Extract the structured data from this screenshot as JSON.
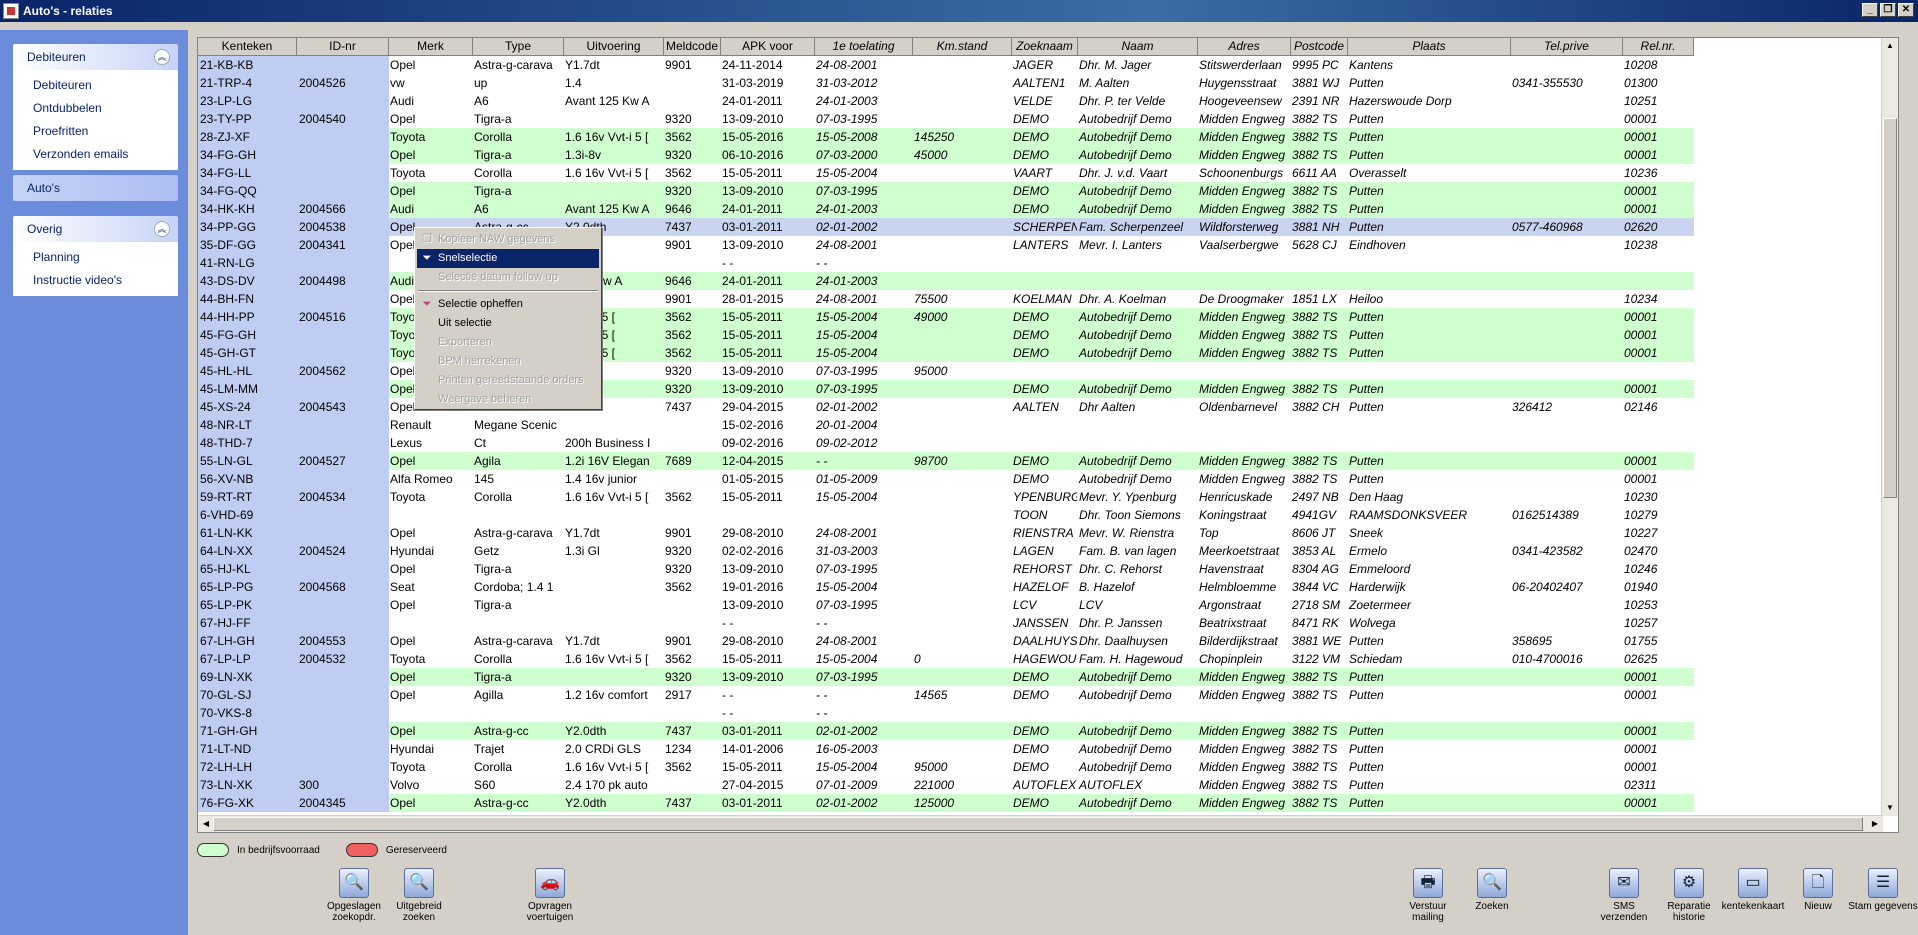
{
  "window": {
    "title": "Auto's - relaties"
  },
  "sidebar": {
    "groups": [
      {
        "title": "Debiteuren",
        "items": [
          "Debiteuren",
          "Ontdubbelen",
          "Proefritten",
          "Verzonden emails"
        ]
      },
      {
        "title": "Auto's",
        "items": []
      },
      {
        "title": "Overig",
        "items": [
          "Planning",
          "Instructie video's"
        ]
      }
    ]
  },
  "grid": {
    "columns": [
      "Kenteken",
      "ID-nr",
      "Merk",
      "Type",
      "Uitvoering",
      "Meldcode",
      "APK voor",
      "1e toelating",
      "Km.stand",
      "Zoeknaam",
      "Naam",
      "Adres",
      "Postcode",
      "Plaats",
      "Tel.prive",
      "Rel.nr."
    ],
    "rows": [
      {
        "s": "",
        "c": [
          "21-KB-KB",
          "",
          "Opel",
          "Astra-g-carava",
          "Y1.7dt",
          "9901",
          "24-11-2014",
          "24-08-2001",
          "",
          "JAGER",
          "Dhr. M. Jager",
          "Stitswerderlaan",
          "9995 PC",
          "Kantens",
          "",
          "10208"
        ]
      },
      {
        "s": "",
        "c": [
          "21-TRP-4",
          "2004526",
          "vw",
          "up",
          "1.4",
          "",
          "31-03-2019",
          "31-03-2012",
          "",
          "AALTEN1",
          "M. Aalten",
          "Huygensstraat",
          "3881 WJ",
          "Putten",
          "0341-355530",
          "01300"
        ]
      },
      {
        "s": "",
        "c": [
          "23-LP-LG",
          "",
          "Audi",
          "A6",
          "Avant 125 Kw A",
          "",
          "24-01-2011",
          "24-01-2003",
          "",
          "VELDE",
          "Dhr. P. ter Velde",
          "Hoogeveensew",
          "2391 NR",
          "Hazerswoude Dorp",
          "",
          "10251"
        ]
      },
      {
        "s": "",
        "c": [
          "23-TY-PP",
          "2004540",
          "Opel",
          "Tigra-a",
          "",
          "9320",
          "13-09-2010",
          "07-03-1995",
          "",
          "DEMO",
          "Autobedrijf Demo",
          "Midden Engweg",
          "3882 TS",
          "Putten",
          "",
          "00001"
        ]
      },
      {
        "s": "g",
        "c": [
          "28-ZJ-XF",
          "",
          "Toyota",
          "Corolla",
          "1.6 16v Vvt-i 5 [",
          "3562",
          "15-05-2016",
          "15-05-2008",
          "145250",
          "DEMO",
          "Autobedrijf Demo",
          "Midden Engweg",
          "3882 TS",
          "Putten",
          "",
          "00001"
        ]
      },
      {
        "s": "g",
        "c": [
          "34-FG-GH",
          "",
          "Opel",
          "Tigra-a",
          "1.3i-8v",
          "9320",
          "06-10-2016",
          "07-03-2000",
          "45000",
          "DEMO",
          "Autobedrijf Demo",
          "Midden Engweg",
          "3882 TS",
          "Putten",
          "",
          "00001"
        ]
      },
      {
        "s": "",
        "c": [
          "34-FG-LL",
          "",
          "Toyota",
          "Corolla",
          "1.6 16v Vvt-i 5 [",
          "3562",
          "15-05-2011",
          "15-05-2004",
          "",
          "VAART",
          "Dhr. J. v.d. Vaart",
          "Schoonenburgs",
          "6611 AA",
          "Overasselt",
          "",
          "10236"
        ]
      },
      {
        "s": "g",
        "c": [
          "34-FG-QQ",
          "",
          "Opel",
          "Tigra-a",
          "",
          "9320",
          "13-09-2010",
          "07-03-1995",
          "",
          "DEMO",
          "Autobedrijf Demo",
          "Midden Engweg",
          "3882 TS",
          "Putten",
          "",
          "00001"
        ]
      },
      {
        "s": "g",
        "c": [
          "34-HK-KH",
          "2004566",
          "Audi",
          "A6",
          "Avant 125 Kw A",
          "9646",
          "24-01-2011",
          "24-01-2003",
          "",
          "DEMO",
          "Autobedrijf Demo",
          "Midden Engweg",
          "3882 TS",
          "Putten",
          "",
          "00001"
        ]
      },
      {
        "s": "sel",
        "c": [
          "34-PP-GG",
          "2004538",
          "Opel",
          "Astra-g-cc",
          "Y2.0dth",
          "7437",
          "03-01-2011",
          "02-01-2002",
          "",
          "SCHERPEN",
          "Fam. Scherpenzeel",
          "Wildforsterweg",
          "3881 NH",
          "Putten",
          "0577-460968",
          "02620"
        ]
      },
      {
        "s": "",
        "c": [
          "35-DF-GG",
          "2004341",
          "Opel",
          "",
          "",
          "9901",
          "13-09-2010",
          "24-08-2001",
          "",
          "LANTERS",
          "Mevr. I. Lanters",
          "Vaalserbergwe",
          "5628 CJ",
          "Eindhoven",
          "",
          "10238"
        ]
      },
      {
        "s": "",
        "c": [
          "41-RN-LG",
          "",
          "",
          "",
          "",
          "",
          "- -",
          "- -",
          "",
          "",
          "",
          "",
          "",
          "",
          "",
          ""
        ]
      },
      {
        "s": "g",
        "c": [
          "43-DS-DV",
          "2004498",
          "Audi",
          "",
          "t 125 Kw A",
          "9646",
          "24-01-2011",
          "24-01-2003",
          "",
          "",
          "",
          "",
          "",
          "",
          "",
          ""
        ]
      },
      {
        "s": "",
        "c": [
          "44-BH-FN",
          "",
          "Opel",
          "",
          "",
          "9901",
          "28-01-2015",
          "24-08-2001",
          "75500",
          "KOELMAN",
          "Dhr. A. Koelman",
          "De Droogmaker",
          "1851 LX",
          "Heiloo",
          "",
          "10234"
        ]
      },
      {
        "s": "g",
        "c": [
          "44-HH-PP",
          "2004516",
          "Toyota",
          "",
          "v Vvt-i 5 [",
          "3562",
          "15-05-2011",
          "15-05-2004",
          "49000",
          "DEMO",
          "Autobedrijf Demo",
          "Midden Engweg",
          "3882 TS",
          "Putten",
          "",
          "00001"
        ]
      },
      {
        "s": "g",
        "c": [
          "45-FG-GH",
          "",
          "Toyota",
          "",
          "v Vvt-i 5 [",
          "3562",
          "15-05-2011",
          "15-05-2004",
          "",
          "DEMO",
          "Autobedrijf Demo",
          "Midden Engweg",
          "3882 TS",
          "Putten",
          "",
          "00001"
        ]
      },
      {
        "s": "g",
        "c": [
          "45-GH-GT",
          "",
          "Toyota",
          "",
          "v Vvt-i 5 [",
          "3562",
          "15-05-2011",
          "15-05-2004",
          "",
          "DEMO",
          "Autobedrijf Demo",
          "Midden Engweg",
          "3882 TS",
          "Putten",
          "",
          "00001"
        ]
      },
      {
        "s": "",
        "c": [
          "45-HL-HL",
          "2004562",
          "Opel",
          "",
          "",
          "9320",
          "13-09-2010",
          "07-03-1995",
          "95000",
          "",
          "",
          "",
          "",
          "",
          "",
          ""
        ]
      },
      {
        "s": "g",
        "c": [
          "45-LM-MM",
          "",
          "Opel",
          "",
          "",
          "9320",
          "13-09-2010",
          "07-03-1995",
          "",
          "DEMO",
          "Autobedrijf Demo",
          "Midden Engweg",
          "3882 TS",
          "Putten",
          "",
          "00001"
        ]
      },
      {
        "s": "",
        "c": [
          "45-XS-24",
          "2004543",
          "Opel",
          "",
          "th",
          "7437",
          "29-04-2015",
          "02-01-2002",
          "",
          "AALTEN",
          "Dhr Aalten",
          "Oldenbarnevel",
          "3882 CH",
          "Putten",
          "326412",
          "02146"
        ]
      },
      {
        "s": "",
        "c": [
          "48-NR-LT",
          "",
          "Renault",
          "Megane Scenic",
          "",
          "",
          "15-02-2016",
          "20-01-2004",
          "",
          "",
          "",
          "",
          "",
          "",
          "",
          ""
        ]
      },
      {
        "s": "",
        "c": [
          "48-THD-7",
          "",
          "Lexus",
          "Ct",
          "200h Business I",
          "",
          "09-02-2016",
          "09-02-2012",
          "",
          "",
          "",
          "",
          "",
          "",
          "",
          ""
        ]
      },
      {
        "s": "g",
        "c": [
          "55-LN-GL",
          "2004527",
          "Opel",
          "Agila",
          "1.2i 16V Elegan",
          "7689",
          "12-04-2015",
          "- -",
          "98700",
          "DEMO",
          "Autobedrijf Demo",
          "Midden Engweg",
          "3882 TS",
          "Putten",
          "",
          "00001"
        ]
      },
      {
        "s": "",
        "c": [
          "56-XV-NB",
          "",
          "Alfa Romeo",
          "145",
          "1.4 16v junior",
          "",
          "01-05-2015",
          "01-05-2009",
          "",
          "DEMO",
          "Autobedrijf Demo",
          "Midden Engweg",
          "3882 TS",
          "Putten",
          "",
          "00001"
        ]
      },
      {
        "s": "",
        "c": [
          "59-RT-RT",
          "2004534",
          "Toyota",
          "Corolla",
          "1.6 16v Vvt-i 5 [",
          "3562",
          "15-05-2011",
          "15-05-2004",
          "",
          "YPENBURG",
          "Mevr. Y. Ypenburg",
          "Henricuskade",
          "2497 NB",
          "Den Haag",
          "",
          "10230"
        ]
      },
      {
        "s": "",
        "c": [
          "6-VHD-69",
          "",
          "",
          "",
          "",
          "",
          "",
          "",
          "",
          "TOON",
          "Dhr. Toon Siemons",
          "Koningstraat",
          "4941GV",
          "RAAMSDONKSVEER",
          "0162514389",
          "10279"
        ]
      },
      {
        "s": "",
        "c": [
          "61-LN-KK",
          "",
          "Opel",
          "Astra-g-carava",
          "Y1.7dt",
          "9901",
          "29-08-2010",
          "24-08-2001",
          "",
          "RIENSTRA",
          "Mevr. W. Rienstra",
          "Top",
          "8606 JT",
          "Sneek",
          "",
          "10227"
        ]
      },
      {
        "s": "",
        "c": [
          "64-LN-XX",
          "2004524",
          "Hyundai",
          "Getz",
          "1.3i Gl",
          "9320",
          "02-02-2016",
          "31-03-2003",
          "",
          "LAGEN",
          "Fam. B. van lagen",
          "Meerkoetstraat",
          "3853 AL",
          "Ermelo",
          "0341-423582",
          "02470"
        ]
      },
      {
        "s": "",
        "c": [
          "65-HJ-KL",
          "",
          "Opel",
          "Tigra-a",
          "",
          "9320",
          "13-09-2010",
          "07-03-1995",
          "",
          "REHORST",
          "Dhr. C. Rehorst",
          "Havenstraat",
          "8304 AG",
          "Emmeloord",
          "",
          "10246"
        ]
      },
      {
        "s": "",
        "c": [
          "65-LP-PG",
          "2004568",
          "Seat",
          "Cordoba; 1.4 1",
          "",
          "3562",
          "19-01-2016",
          "15-05-2004",
          "",
          "HAZELOF",
          "B. Hazelof",
          "Helmbloemme",
          "3844 VC",
          "Harderwijk",
          "06-20402407",
          "01940"
        ]
      },
      {
        "s": "",
        "c": [
          "65-LP-PK",
          "",
          "Opel",
          "Tigra-a",
          "",
          "",
          "13-09-2010",
          "07-03-1995",
          "",
          "LCV",
          "LCV",
          "Argonstraat",
          "2718 SM",
          "Zoetermeer",
          "",
          "10253"
        ]
      },
      {
        "s": "",
        "c": [
          "67-HJ-FF",
          "",
          "",
          "",
          "",
          "",
          "- -",
          "- -",
          "",
          "JANSSEN",
          "Dhr. P. Janssen",
          "Beatrixstraat",
          "8471 RK",
          "Wolvega",
          "",
          "10257"
        ]
      },
      {
        "s": "",
        "c": [
          "67-LH-GH",
          "2004553",
          "Opel",
          "Astra-g-carava",
          "Y1.7dt",
          "9901",
          "29-08-2010",
          "24-08-2001",
          "",
          "DAALHUYS",
          "Dhr. Daalhuysen",
          "Bilderdijkstraat",
          "3881 WE",
          "Putten",
          "358695",
          "01755"
        ]
      },
      {
        "s": "",
        "c": [
          "67-LP-LP",
          "2004532",
          "Toyota",
          "Corolla",
          "1.6 16v Vvt-i 5 [",
          "3562",
          "15-05-2011",
          "15-05-2004",
          "0",
          "HAGEWOU",
          "Fam. H. Hagewoud",
          "Chopinplein",
          "3122 VM",
          "Schiedam",
          "010-4700016",
          "02625"
        ]
      },
      {
        "s": "g",
        "c": [
          "69-LN-XK",
          "",
          "Opel",
          "Tigra-a",
          "",
          "9320",
          "13-09-2010",
          "07-03-1995",
          "",
          "DEMO",
          "Autobedrijf Demo",
          "Midden Engweg",
          "3882 TS",
          "Putten",
          "",
          "00001"
        ]
      },
      {
        "s": "",
        "c": [
          "70-GL-SJ",
          "",
          "Opel",
          "Agilla",
          "1.2 16v comfort",
          "2917",
          "- -",
          "- -",
          "14565",
          "DEMO",
          "Autobedrijf Demo",
          "Midden Engweg",
          "3882 TS",
          "Putten",
          "",
          "00001"
        ]
      },
      {
        "s": "",
        "c": [
          "70-VKS-8",
          "",
          "",
          "",
          "",
          "",
          "- -",
          "- -",
          "",
          "",
          "",
          "",
          "",
          "",
          "",
          ""
        ]
      },
      {
        "s": "g",
        "c": [
          "71-GH-GH",
          "",
          "Opel",
          "Astra-g-cc",
          "Y2.0dth",
          "7437",
          "03-01-2011",
          "02-01-2002",
          "",
          "DEMO",
          "Autobedrijf Demo",
          "Midden Engweg",
          "3882 TS",
          "Putten",
          "",
          "00001"
        ]
      },
      {
        "s": "",
        "c": [
          "71-LT-ND",
          "",
          "Hyundai",
          "Trajet",
          "2.0 CRDi GLS",
          "1234",
          "14-01-2006",
          "16-05-2003",
          "",
          "DEMO",
          "Autobedrijf Demo",
          "Midden Engweg",
          "3882 TS",
          "Putten",
          "",
          "00001"
        ]
      },
      {
        "s": "",
        "c": [
          "72-LH-LH",
          "",
          "Toyota",
          "Corolla",
          "1.6 16v Vvt-i 5 [",
          "3562",
          "15-05-2011",
          "15-05-2004",
          "95000",
          "DEMO",
          "Autobedrijf Demo",
          "Midden Engweg",
          "3882 TS",
          "Putten",
          "",
          "00001"
        ]
      },
      {
        "s": "",
        "c": [
          "73-LN-XK",
          "300",
          "Volvo",
          "S60",
          "2.4 170 pk auto",
          "",
          "27-04-2015",
          "07-01-2009",
          "221000",
          "AUTOFLEX",
          "AUTOFLEX",
          "Midden Engweg",
          "3882 TS",
          "Putten",
          "",
          "02311"
        ]
      },
      {
        "s": "g",
        "c": [
          "76-FG-XK",
          "2004345",
          "Opel",
          "Astra-g-cc",
          "Y2.0dth",
          "7437",
          "03-01-2011",
          "02-01-2002",
          "125000",
          "DEMO",
          "Autobedrijf Demo",
          "Midden Engweg",
          "3882 TS",
          "Putten",
          "",
          "00001"
        ]
      }
    ]
  },
  "context_menu": {
    "items": [
      {
        "label": "Kopieer NAW gegevens",
        "disabled": true,
        "icon": "copy-icon"
      },
      {
        "label": "Snelselectie",
        "disabled": false,
        "highlighted": true,
        "icon": "funnel-icon"
      },
      {
        "label": "Selectie datum follow-up",
        "disabled": true
      },
      {
        "sep": true
      },
      {
        "label": "Selectie opheffen",
        "disabled": false,
        "icon": "funnel-clear-icon"
      },
      {
        "label": "Uit selectie",
        "disabled": false
      },
      {
        "label": "Exporteren",
        "disabled": true
      },
      {
        "label": "BPM herrekenen",
        "disabled": true
      },
      {
        "label": "Printen gereedstaande orders",
        "disabled": true
      },
      {
        "label": "Weergave beheren",
        "disabled": true
      }
    ]
  },
  "legend": {
    "items": [
      {
        "label": "In bedrijfsvoorraad",
        "color": "#cfffcf"
      },
      {
        "label": "Gereserveerd",
        "color": "#f06060"
      }
    ]
  },
  "toolbar": {
    "buttons": [
      {
        "label": "Opgeslagen zoekopdr.",
        "icon": "saved-search-icon"
      },
      {
        "label": "Uitgebreid zoeken",
        "icon": "magnifier-icon"
      },
      {
        "label": "Opvragen voertuigen",
        "icon": "car-query-icon"
      },
      {
        "label": "Verstuur mailing",
        "icon": "printer-icon"
      },
      {
        "label": "Zoeken",
        "icon": "magnifier-icon"
      },
      {
        "label": "SMS verzenden",
        "icon": "sms-icon"
      },
      {
        "label": "Reparatie historie",
        "icon": "repair-history-icon"
      },
      {
        "label": "kentekenkaart",
        "icon": "card-icon"
      },
      {
        "label": "Nieuw",
        "icon": "new-document-icon"
      },
      {
        "label": "Stam gegevens",
        "icon": "master-data-icon"
      }
    ]
  },
  "colors": {
    "accent": "#0a246a",
    "sidebar": "#6b8cdb",
    "stock_row": "#cfffcf",
    "selected_row": "#c9d4f0",
    "key_column": "#c0cdf2"
  }
}
